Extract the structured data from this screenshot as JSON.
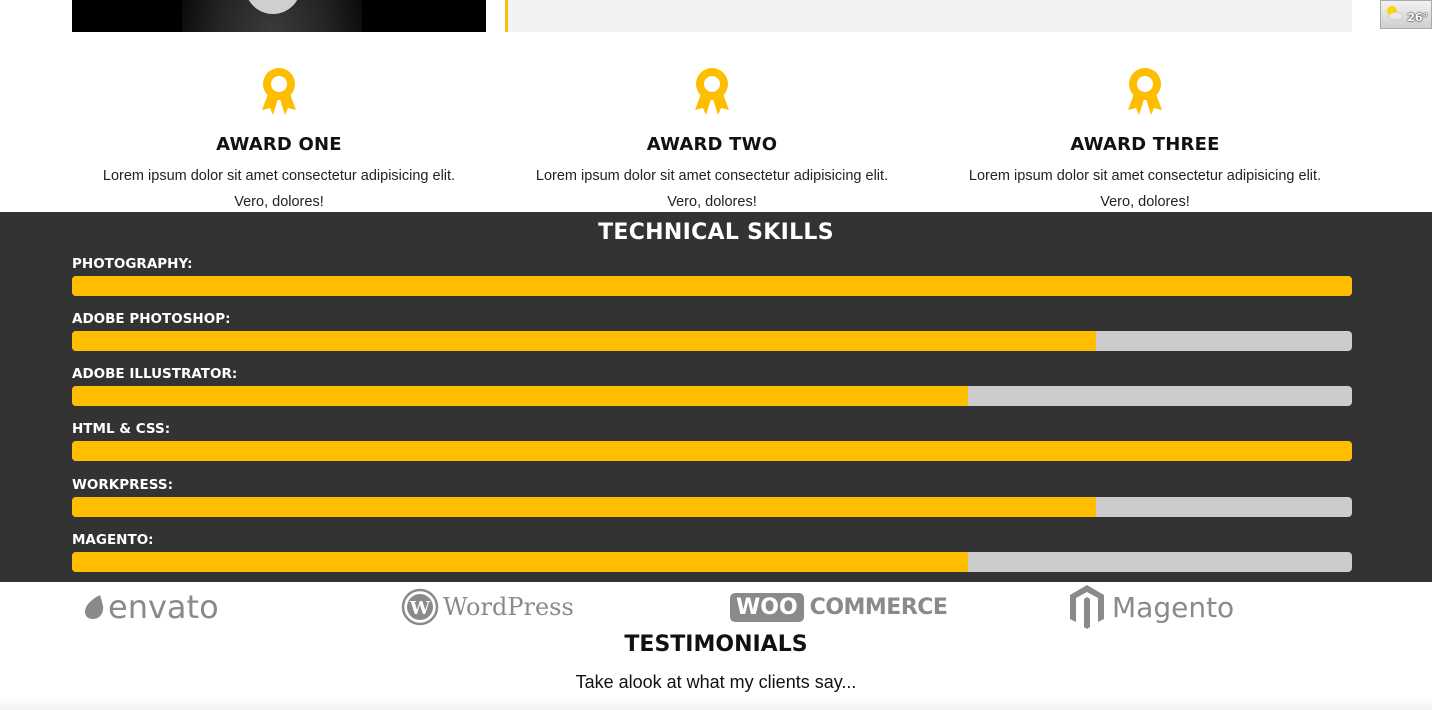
{
  "weather": {
    "temperature": "26°",
    "icon": "partly-sunny-icon"
  },
  "awards": [
    {
      "title": "AWARD ONE",
      "text": "Lorem ipsum dolor sit amet consectetur adipisicing elit. Vero, dolores!",
      "icon": "award-ribbon-icon"
    },
    {
      "title": "AWARD TWO",
      "text": "Lorem ipsum dolor sit amet consectetur adipisicing elit. Vero, dolores!",
      "icon": "award-ribbon-icon"
    },
    {
      "title": "AWARD THREE",
      "text": "Lorem ipsum dolor sit amet consectetur adipisicing elit. Vero, dolores!",
      "icon": "award-ribbon-icon"
    }
  ],
  "skills": {
    "title": "TECHNICAL SKILLS",
    "items": [
      {
        "label": "PHOTOGRAPHY:",
        "percent": 100
      },
      {
        "label": "ADOBE PHOTOSHOP:",
        "percent": 80
      },
      {
        "label": "ADOBE ILLUSTRATOR:",
        "percent": 70
      },
      {
        "label": "HTML & CSS:",
        "percent": 100
      },
      {
        "label": "WORKPRESS:",
        "percent": 80
      },
      {
        "label": "MAGENTO:",
        "percent": 70
      }
    ]
  },
  "logos": {
    "envato": "envato",
    "wordpress": "WordPress",
    "woo": "WOO",
    "commerce": "COMMERCE",
    "magento": "Magento"
  },
  "testimonials": {
    "title": "TESTIMONIALS",
    "subtitle": "Take alook at what my clients say..."
  },
  "colors": {
    "accent": "#ffbd00",
    "dark": "#333333",
    "track": "#cccccc"
  }
}
